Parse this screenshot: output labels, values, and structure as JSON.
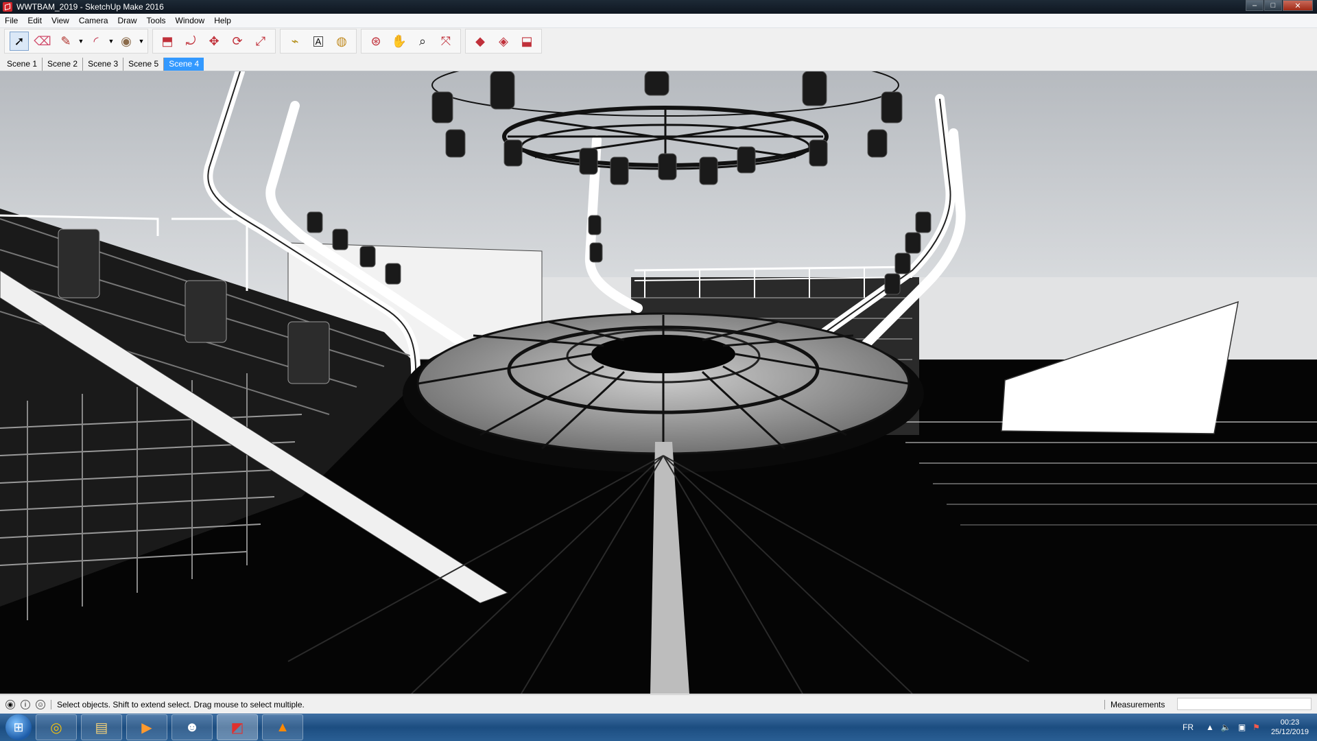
{
  "window": {
    "title": "WWTBAM_2019 - SketchUp Make 2016",
    "controls": {
      "minimize": "–",
      "maximize": "□",
      "close": "✕"
    }
  },
  "menu": {
    "items": [
      "File",
      "Edit",
      "View",
      "Camera",
      "Draw",
      "Tools",
      "Window",
      "Help"
    ]
  },
  "toolbar": {
    "tools": [
      {
        "icon": "select-icon",
        "glyph": "➚"
      },
      {
        "icon": "eraser-icon",
        "glyph": "⌫"
      },
      {
        "icon": "line-pencil-icon",
        "glyph": "✎"
      },
      {
        "icon": "arc-icon",
        "glyph": "◜"
      },
      {
        "icon": "circle-icon",
        "glyph": "◉"
      },
      {
        "icon": "push-pull-icon",
        "glyph": "⬒"
      },
      {
        "icon": "offset-icon",
        "glyph": "⤾"
      },
      {
        "icon": "move-icon",
        "glyph": "✥"
      },
      {
        "icon": "rotate-icon",
        "glyph": "⟳"
      },
      {
        "icon": "scale-icon",
        "glyph": "⤢"
      },
      {
        "icon": "tape-measure-icon",
        "glyph": "⌁"
      },
      {
        "icon": "text-icon",
        "glyph": "A"
      },
      {
        "icon": "paint-bucket-icon",
        "glyph": "◍"
      },
      {
        "icon": "orbit-icon",
        "glyph": "⊛"
      },
      {
        "icon": "pan-icon",
        "glyph": "✋"
      },
      {
        "icon": "zoom-icon",
        "glyph": "⌕"
      },
      {
        "icon": "zoom-extents-icon",
        "glyph": "⤧"
      },
      {
        "icon": "3d-warehouse-icon",
        "glyph": "◆"
      },
      {
        "icon": "extension-warehouse-icon",
        "glyph": "◈"
      },
      {
        "icon": "share-model-icon",
        "glyph": "⬓"
      }
    ]
  },
  "scenes": {
    "tabs": [
      "Scene 1",
      "Scene 2",
      "Scene 3",
      "Scene 5",
      "Scene 4"
    ],
    "active": "Scene 4"
  },
  "status": {
    "message": "Select objects. Shift to extend select. Drag mouse to select multiple.",
    "measurements_label": "Measurements",
    "measurements_value": ""
  },
  "taskbar": {
    "apps": [
      {
        "icon": "chrome-icon",
        "glyph": "◎"
      },
      {
        "icon": "file-explorer-icon",
        "glyph": "▤"
      },
      {
        "icon": "media-player-icon",
        "glyph": "▶"
      },
      {
        "icon": "discord-icon",
        "glyph": "☻"
      },
      {
        "icon": "sketchup-icon",
        "glyph": "◩"
      },
      {
        "icon": "vlc-icon",
        "glyph": "▲"
      }
    ],
    "language": "FR",
    "time": "00:23",
    "date": "25/12/2019"
  }
}
